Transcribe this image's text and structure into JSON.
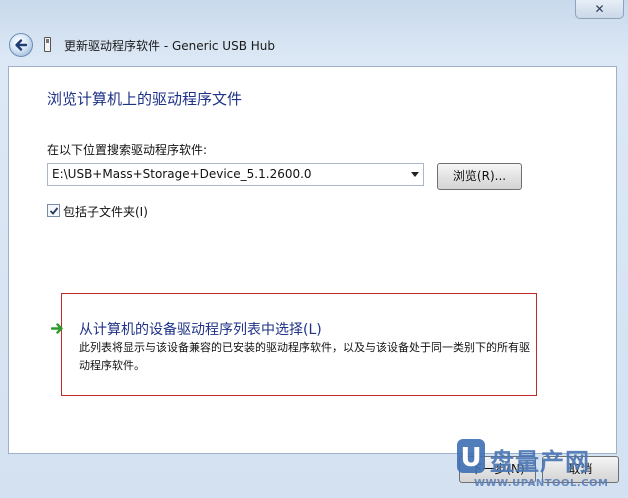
{
  "window": {
    "title": "更新驱动程序软件 - Generic USB Hub",
    "close_glyph": "✕"
  },
  "page": {
    "heading": "浏览计算机上的驱动程序文件",
    "search_label": "在以下位置搜索驱动程序软件:",
    "path_value": "E:\\USB+Mass+Storage+Device_5.1.2600.0",
    "browse_label": "浏览(R)...",
    "include_subfolders_label": "包括子文件夹(I)",
    "include_subfolders_checked": true
  },
  "pick_option": {
    "title": "从计算机的设备驱动程序列表中选择(L)",
    "description": "此列表将显示与该设备兼容的已安装的驱动程序软件，以及与该设备处于同一类别下的所有驱动程序软件。",
    "highlight_color": "#c0282a"
  },
  "footer": {
    "next_label": "下一步(N)",
    "cancel_label": "取消"
  },
  "watermark": {
    "logo_letter": "U",
    "brand": "盘量产网",
    "url": "WWW.UPANTOOL.COM"
  },
  "colors": {
    "heading_blue": "#1e3287",
    "window_frame": "#dce8f5"
  },
  "icons": [
    "back-arrow-icon",
    "usb-device-icon",
    "close-icon",
    "dropdown-arrow-icon",
    "checkmark-icon",
    "green-arrow-icon"
  ]
}
